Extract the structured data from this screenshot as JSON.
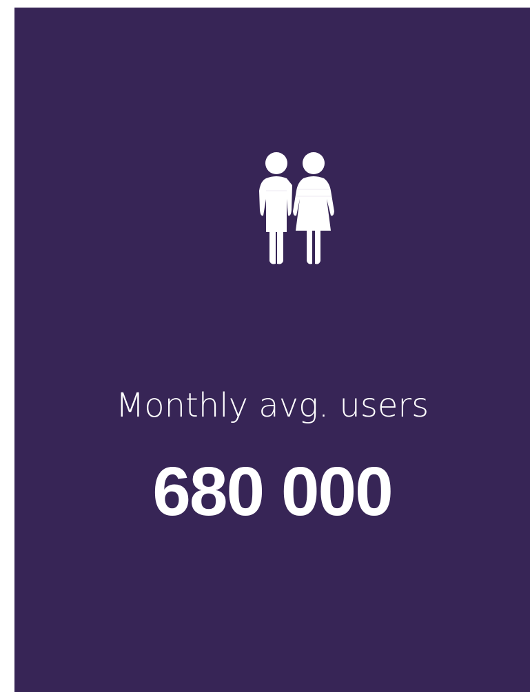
{
  "card": {
    "background_color": "#372556",
    "text_color": "#ffffff",
    "icon": "couple-people-icon",
    "label": "Monthly avg. users",
    "value": "680 000"
  }
}
